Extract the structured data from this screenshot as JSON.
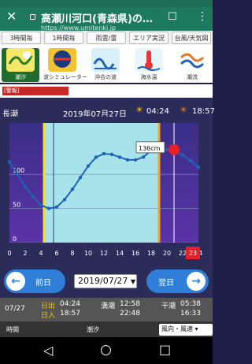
{
  "browser": {
    "title": "高瀬川河口(青森県)の…",
    "url": "https://www.umitenki.jp",
    "close_glyph": "✕",
    "bookmark_glyph": "☐",
    "menu_glyph": "⋮"
  },
  "tabs": [
    "3時間毎",
    "1時間毎",
    "雨雲/雷",
    "エリア実況",
    "台風/天気図"
  ],
  "icon_menu": [
    {
      "label": "潮汐",
      "icon": "tide-icon"
    },
    {
      "label": "波シミュレーター",
      "icon": "wave-simulator-icon"
    },
    {
      "label": "沖合の波",
      "icon": "offshore-wave-icon"
    },
    {
      "label": "海水温",
      "icon": "sea-temp-icon"
    },
    {
      "label": "潮流",
      "icon": "tidal-current-icon"
    }
  ],
  "warning": {
    "label": "[警報]"
  },
  "chart_header": {
    "tide_type": "長潮",
    "date": "2019年07月27日",
    "sunrise": "04:24",
    "sunset": "18:57"
  },
  "chart_data": {
    "type": "line",
    "x": [
      0,
      1,
      2,
      3,
      4,
      5,
      6,
      7,
      8,
      9,
      10,
      11,
      12,
      13,
      14,
      15,
      16,
      17,
      18,
      19,
      20,
      21,
      22,
      23,
      24
    ],
    "values": [
      118,
      100,
      82,
      67,
      55,
      50,
      52,
      63,
      78,
      95,
      112,
      125,
      130,
      129,
      125,
      121,
      121,
      125,
      135,
      136,
      136,
      134,
      128,
      120,
      110
    ],
    "xticks": [
      "0",
      "2",
      "4",
      "6",
      "8",
      "10",
      "12",
      "14",
      "16",
      "18",
      "20",
      "22",
      "24"
    ],
    "yticks": [
      "0",
      "50",
      "100"
    ],
    "ylim": [
      0,
      175
    ],
    "xlim": [
      0,
      24
    ],
    "tooltip": "136cm",
    "current_day_badge": "23",
    "colors": {
      "line": "#1e63b8",
      "fill": "#a8e3ec",
      "bg": "#2c2c5a",
      "sunrise": "#f5e027",
      "sunset": "#f5a020",
      "marker": "#e5202a"
    }
  },
  "date_nav": {
    "prev_label": "前日",
    "next_label": "翌日",
    "prev_glyph": "←",
    "next_glyph": "→",
    "selected_date": "2019/07/27"
  },
  "info_row": {
    "date": "07/27",
    "sun_label1": "日出",
    "sun_label2": "日入",
    "sunrise": "04:24",
    "sunset": "18:57",
    "high_label": "満潮",
    "high1": "12:58",
    "high2": "22:48",
    "low_label": "干潮",
    "low1": "05:38",
    "low2": "16:33"
  },
  "table_header": {
    "time": "時間",
    "tide": "潮汐",
    "wind_select": "風向・風速"
  },
  "android_nav": {
    "back": "◁",
    "home": "○",
    "recent": "□"
  }
}
